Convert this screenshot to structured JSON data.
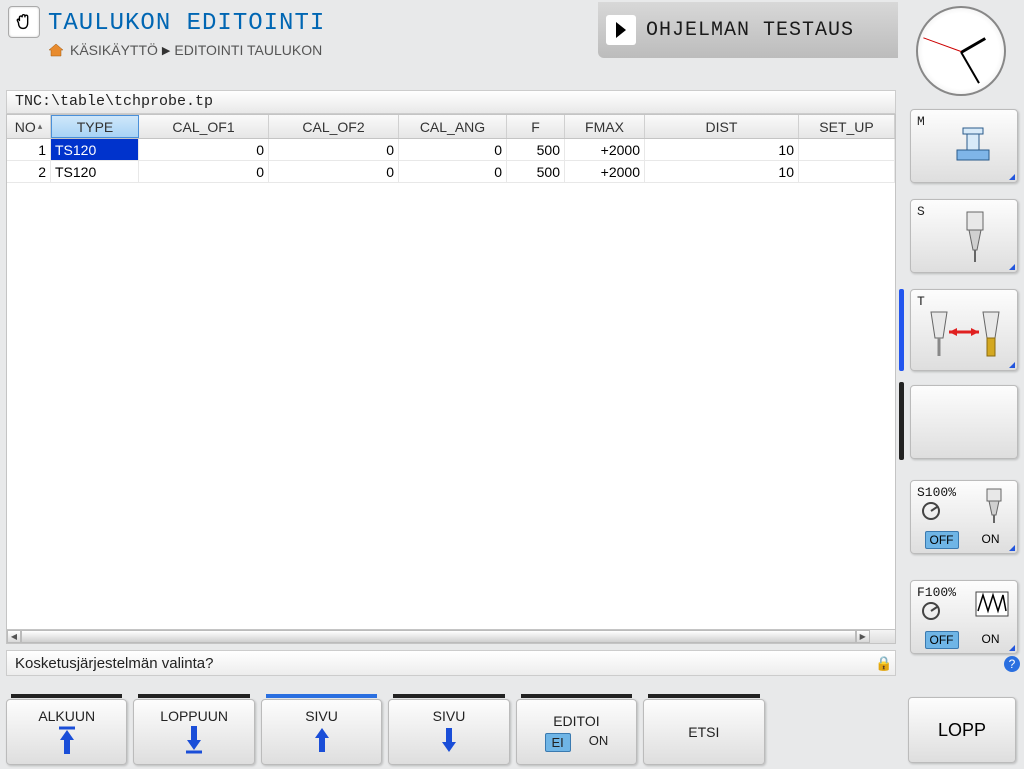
{
  "header": {
    "title": "TAULUKON EDITOINTI",
    "breadcrumb1": "KÄSIKÄYTTÖ",
    "breadcrumb2": "EDITOINTI TAULUKON",
    "tabRight": "OHJELMAN TESTAUS"
  },
  "path": "TNC:\\table\\tchprobe.tp",
  "table": {
    "headers": [
      "NO",
      "TYPE",
      "CAL_OF1",
      "CAL_OF2",
      "CAL_ANG",
      "F",
      "FMAX",
      "DIST",
      "SET_UP"
    ],
    "rows": [
      {
        "no": "1",
        "type": "TS120",
        "of1": "0",
        "of2": "0",
        "ang": "0",
        "f": "500",
        "fmax": "+2000",
        "dist": "10",
        "setup": ""
      },
      {
        "no": "2",
        "type": "TS120",
        "of1": "0",
        "of2": "0",
        "ang": "0",
        "f": "500",
        "fmax": "+2000",
        "dist": "10",
        "setup": ""
      }
    ]
  },
  "status": "Kosketusjärjestelmän valinta?",
  "side": {
    "m": "M",
    "s": "S",
    "t": "T",
    "s100": "S100%",
    "f100": "F100%",
    "off": "OFF",
    "on": "ON"
  },
  "softkeys": {
    "alkuun": "ALKUUN",
    "loppuun": "LOPPUUN",
    "sivu1": "SIVU",
    "sivu2": "SIVU",
    "editoi": "EDITOI",
    "ei": "EI",
    "on": "ON",
    "etsi": "ETSI",
    "lopp": "LOPP"
  }
}
